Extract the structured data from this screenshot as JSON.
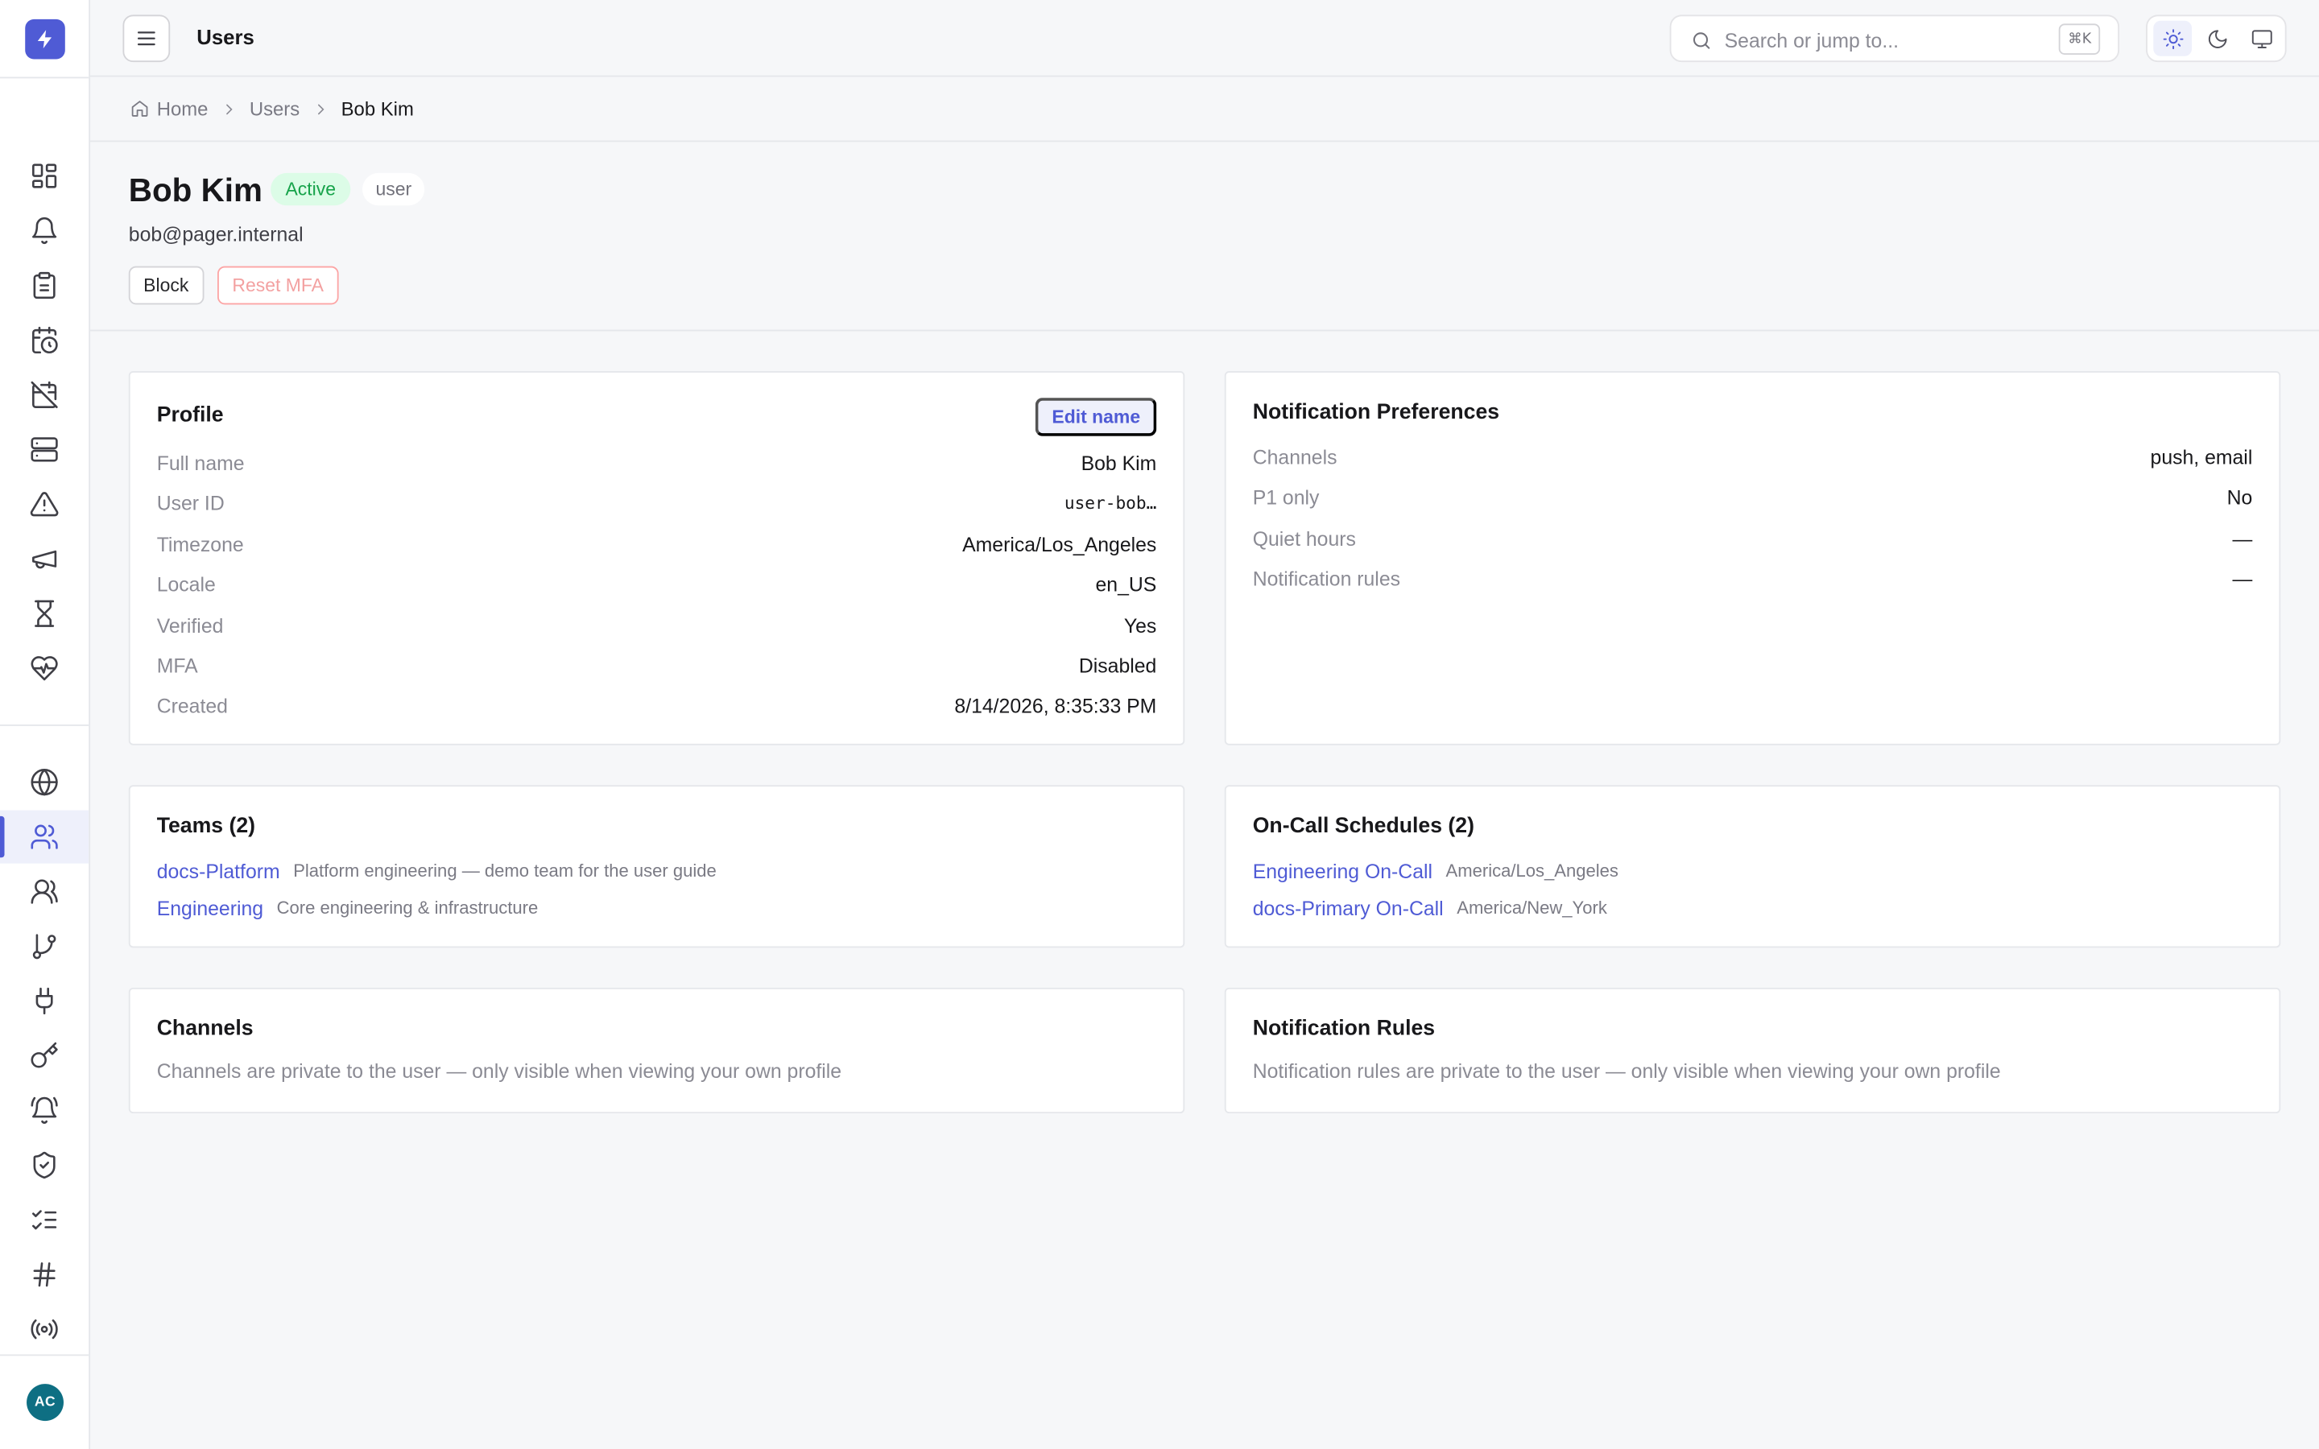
{
  "sidebar": {
    "logo_icon": "bolt-icon",
    "nav_primary": [
      {
        "icon": "dashboard-grid-icon"
      },
      {
        "icon": "bell-icon"
      },
      {
        "icon": "clipboard-icon"
      },
      {
        "icon": "calendar-clock-icon"
      },
      {
        "icon": "calendar-off-icon"
      },
      {
        "icon": "server-icon"
      },
      {
        "icon": "alert-triangle-icon"
      },
      {
        "icon": "megaphone-icon"
      },
      {
        "icon": "hourglass-icon"
      },
      {
        "icon": "heart-pulse-icon"
      }
    ],
    "nav_secondary": [
      {
        "icon": "globe-icon"
      },
      {
        "icon": "users-icon",
        "active": true
      },
      {
        "icon": "teams-icon"
      },
      {
        "icon": "git-branch-icon"
      },
      {
        "icon": "plug-icon"
      },
      {
        "icon": "key-icon"
      },
      {
        "icon": "bell-ring-icon"
      },
      {
        "icon": "shield-check-icon"
      },
      {
        "icon": "list-checks-icon"
      },
      {
        "icon": "hash-icon"
      },
      {
        "icon": "radio-icon"
      }
    ],
    "user_initials": "AC",
    "accent_color": "#4f5bd5",
    "avatar_color": "#0e6f83"
  },
  "topbar": {
    "title": "Users",
    "search_placeholder": "Search or jump to...",
    "search_shortcut": "⌘K",
    "theme_options": [
      "light",
      "dark",
      "system"
    ],
    "theme_selected": "light"
  },
  "breadcrumb": {
    "home": "Home",
    "section": "Users",
    "current": "Bob Kim"
  },
  "user": {
    "name": "Bob Kim",
    "status": "Active",
    "role": "user",
    "email": "bob@pager.internal",
    "block_label": "Block",
    "reset_mfa_label": "Reset MFA"
  },
  "profile": {
    "title": "Profile",
    "edit_label": "Edit name",
    "rows": [
      {
        "label": "Full name",
        "value": "Bob Kim"
      },
      {
        "label": "User ID",
        "value": "user-bob…"
      },
      {
        "label": "Timezone",
        "value": "America/Los_Angeles"
      },
      {
        "label": "Locale",
        "value": "en_US"
      },
      {
        "label": "Verified",
        "value": "Yes"
      },
      {
        "label": "MFA",
        "value": "Disabled"
      },
      {
        "label": "Created",
        "value": "8/14/2026, 8:35:33 PM"
      }
    ]
  },
  "notification_preferences": {
    "title": "Notification Preferences",
    "rows": [
      {
        "label": "Channels",
        "value": "push, email"
      },
      {
        "label": "P1 only",
        "value": "No"
      },
      {
        "label": "Quiet hours",
        "value": "—"
      },
      {
        "label": "Notification rules",
        "value": "—"
      }
    ]
  },
  "teams": {
    "title": "Teams (2)",
    "items": [
      {
        "name": "docs-Platform",
        "description": "Platform engineering — demo team for the user guide"
      },
      {
        "name": "Engineering",
        "description": "Core engineering & infrastructure"
      }
    ]
  },
  "schedules": {
    "title": "On-Call Schedules (2)",
    "items": [
      {
        "name": "Engineering On-Call",
        "timezone": "America/Los_Angeles"
      },
      {
        "name": "docs-Primary On-Call",
        "timezone": "America/New_York"
      }
    ]
  },
  "channels": {
    "title": "Channels",
    "message": "Channels are private to the user — only visible when viewing your own profile"
  },
  "notification_rules": {
    "title": "Notification Rules",
    "message": "Notification rules are private to the user — only visible when viewing your own profile"
  }
}
